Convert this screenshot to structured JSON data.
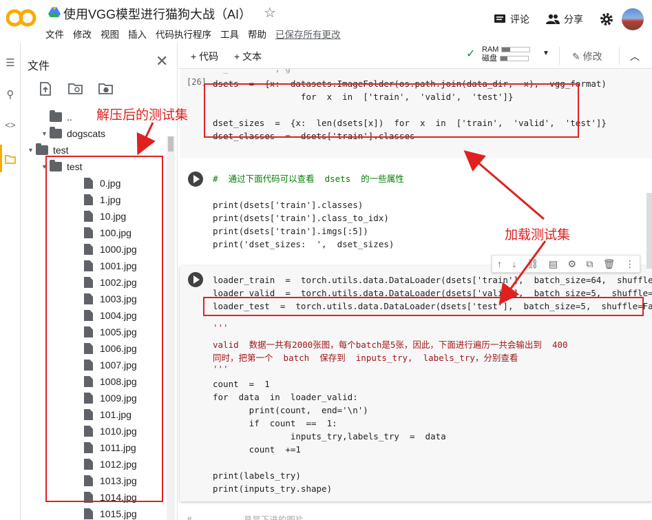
{
  "app": {
    "title": "使用VGG模型进行猫狗大战（AI）",
    "menu": [
      "文件",
      "修改",
      "视图",
      "插入",
      "代码执行程序",
      "工具",
      "帮助"
    ],
    "saved_status": "已保存所有更改",
    "comment_label": "评论",
    "share_label": "分享"
  },
  "files_panel": {
    "title": "文件",
    "tree": [
      {
        "label": "..",
        "type": "up",
        "indent": 0
      },
      {
        "label": "dogscats",
        "type": "folder",
        "indent": 0,
        "expanded": true
      },
      {
        "label": "test",
        "type": "folder",
        "indent": 1,
        "expanded": true
      },
      {
        "label": "test",
        "type": "folder",
        "indent": 2,
        "expanded": true
      },
      {
        "label": "0.jpg",
        "type": "file",
        "indent": 3
      },
      {
        "label": "1.jpg",
        "type": "file",
        "indent": 3
      },
      {
        "label": "10.jpg",
        "type": "file",
        "indent": 3
      },
      {
        "label": "100.jpg",
        "type": "file",
        "indent": 3
      },
      {
        "label": "1000.jpg",
        "type": "file",
        "indent": 3
      },
      {
        "label": "1001.jpg",
        "type": "file",
        "indent": 3
      },
      {
        "label": "1002.jpg",
        "type": "file",
        "indent": 3
      },
      {
        "label": "1003.jpg",
        "type": "file",
        "indent": 3
      },
      {
        "label": "1004.jpg",
        "type": "file",
        "indent": 3
      },
      {
        "label": "1005.jpg",
        "type": "file",
        "indent": 3
      },
      {
        "label": "1006.jpg",
        "type": "file",
        "indent": 3
      },
      {
        "label": "1007.jpg",
        "type": "file",
        "indent": 3
      },
      {
        "label": "1008.jpg",
        "type": "file",
        "indent": 3
      },
      {
        "label": "1009.jpg",
        "type": "file",
        "indent": 3
      },
      {
        "label": "101.jpg",
        "type": "file",
        "indent": 3
      },
      {
        "label": "1010.jpg",
        "type": "file",
        "indent": 3
      },
      {
        "label": "1011.jpg",
        "type": "file",
        "indent": 3
      },
      {
        "label": "1012.jpg",
        "type": "file",
        "indent": 3
      },
      {
        "label": "1013.jpg",
        "type": "file",
        "indent": 3
      },
      {
        "label": "1014.jpg",
        "type": "file",
        "indent": 3
      },
      {
        "label": "1015.jpg",
        "type": "file",
        "indent": 3
      }
    ]
  },
  "toolbar": {
    "add_code": "+ 代码",
    "add_text": "+ 文本",
    "ram_label": "RAM",
    "disk_label": "磁盘",
    "ram_usage": 0.3,
    "disk_usage": 0.25,
    "edit_label": "修改"
  },
  "cells": {
    "cell1_exec": "[26]",
    "cell1_partial": "  _         , g",
    "cell1_line1": "dsets  =  {x:  datasets.ImageFolder(os.path.join(data_dir,  x),  vgg_format)",
    "cell1_line2": "                 for  x  in  ['train',  'valid',  'test']}",
    "cell1_line3": "dset_sizes  =  {x:  len(dsets[x])  for  x  in  ['train',  'valid',  'test']}",
    "cell1_line4": "dset_classes  =  dsets['train'].classes",
    "cell2_line1": "#  通过下面代码可以查看  dsets  的一些属性",
    "cell2_line2": "print(dsets['train'].classes)",
    "cell2_line3": "print(dsets['train'].class_to_idx)",
    "cell2_line4": "print(dsets['train'].imgs[:5])",
    "cell2_line5": "print('dset_sizes:  ',  dset_sizes)",
    "cell3_line1": "loader_train  =  torch.utils.data.DataLoader(dsets['train'],  batch_size=64,  shuffle=Tru",
    "cell3_line2": "loader_valid  =  torch.utils.data.DataLoader(dsets['valid'],  batch_size=5,  shuffle=Fals",
    "cell3_line3": "loader_test  =  torch.utils.data.DataLoader(dsets['test'],  batch_size=5,  shuffle=False,",
    "cell3_line4": "'''",
    "cell3_line5": "valid  数据一共有2000张图，每个batch是5张，因此，下面进行遍历一共会输出到  400",
    "cell3_line6": "同时，把第一个  batch  保存到  inputs_try,  labels_try，分别查看",
    "cell3_line7": "'''",
    "cell3_line8": "count  =  1",
    "cell3_line9": "for  data  in  loader_valid:",
    "cell3_line10": "       print(count,  end='\\n')",
    "cell3_line11": "       if  count  ==  1:",
    "cell3_line12": "               inputs_try,labels_try  =  data",
    "cell3_line13": "       count  +=1",
    "cell3_line14": "print(labels_try)",
    "cell3_line15": "print(inputs_try.shape)",
    "cell4_partial": "#          具显下进的图片"
  },
  "annotations": {
    "label1": "解压后的测试集",
    "label2": "加载测试集"
  }
}
